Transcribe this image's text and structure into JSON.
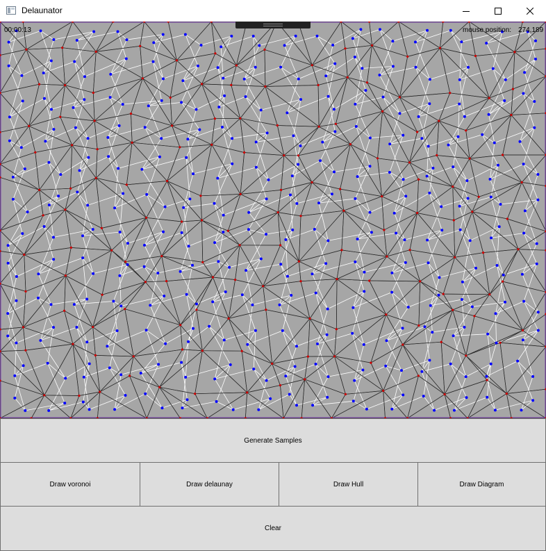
{
  "window": {
    "title": "Delaunator",
    "minimize_icon": "minimize-icon",
    "maximize_icon": "maximize-icon",
    "close_icon": "close-icon"
  },
  "canvas": {
    "timer": "00:00:13",
    "mouse_label": "mouse position:",
    "mouse_value": "274,189",
    "background": "#a6a6a6",
    "site_color": "#cc0000",
    "circumcenter_color": "#0000ff",
    "delaunay_edge_color": "#2a2a2a",
    "voronoi_edge_color": "#ffffff",
    "hull_color": "#7b3fb0"
  },
  "buttons": {
    "generate": "Generate Samples",
    "voronoi": "Draw voronoi",
    "delaunay": "Draw delaunay",
    "hull": "Draw Hull",
    "diagram": "Draw Diagram",
    "clear": "Clear"
  }
}
